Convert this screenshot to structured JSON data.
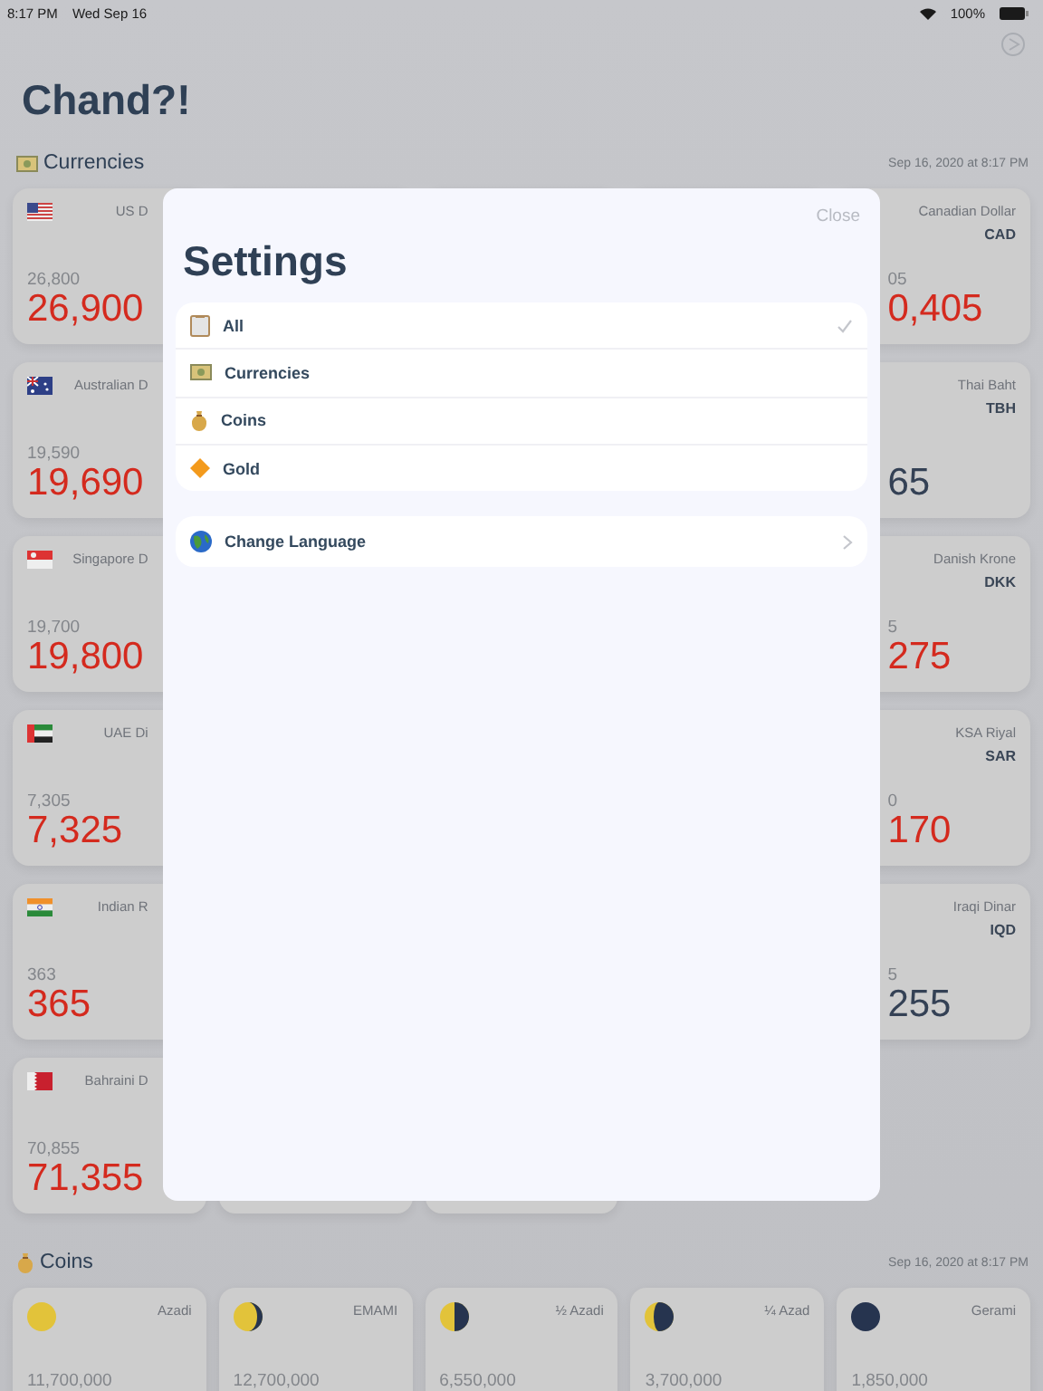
{
  "status_bar": {
    "time": "8:17 PM",
    "date": "Wed Sep 16",
    "battery": "100%"
  },
  "app_title": "Chand?!",
  "currencies": {
    "title": "Currencies",
    "updated": "Sep 16, 2020 at 8:17 PM",
    "rows": [
      {
        "left": {
          "name": "US D",
          "previous": "26,800",
          "price": "26,900",
          "rising": true
        },
        "right": {
          "name": "Canadian Dollar",
          "code": "CAD",
          "previous": "05",
          "price": "0,405",
          "rising": true
        }
      },
      {
        "left": {
          "name": "Australian D",
          "previous": "19,590",
          "price": "19,690",
          "rising": true
        },
        "right": {
          "name": "Thai Baht",
          "code": "TBH",
          "price": "65",
          "rising": false
        }
      },
      {
        "left": {
          "name": "Singapore D",
          "previous": "19,700",
          "price": "19,800",
          "rising": true
        },
        "right": {
          "name": "Danish Krone",
          "code": "DKK",
          "previous": "5",
          "price": "275",
          "rising": true
        }
      },
      {
        "left": {
          "name": "UAE Di",
          "previous": "7,305",
          "price": "7,325",
          "rising": true
        },
        "right": {
          "name": "KSA Riyal",
          "code": "SAR",
          "previous": "0",
          "price": "170",
          "rising": true
        }
      },
      {
        "left": {
          "name": "Indian R",
          "previous": "363",
          "price": "365",
          "rising": true
        },
        "right": {
          "name": "Iraqi Dinar",
          "code": "IQD",
          "previous": "5",
          "price": "255",
          "rising": false
        }
      },
      {
        "left": {
          "name": "Bahraini D",
          "previous": "70,855",
          "price": "71,355",
          "rising": true
        }
      }
    ]
  },
  "coins": {
    "title": "Coins",
    "updated": "Sep 16, 2020 at 8:17 PM",
    "cards": [
      {
        "name": "Azadi",
        "price": "11,700,000"
      },
      {
        "name": "EMAMI",
        "price": "12,700,000"
      },
      {
        "name": "½ Azadi",
        "price": "6,550,000"
      },
      {
        "name": "¼ Azad",
        "price": "3,700,000"
      },
      {
        "name": "Gerami",
        "price": "1,850,000"
      }
    ]
  },
  "settings": {
    "close": "Close",
    "title": "Settings",
    "filters": [
      {
        "label": "All",
        "selected": true
      },
      {
        "label": "Currencies",
        "selected": false
      },
      {
        "label": "Coins",
        "selected": false
      },
      {
        "label": "Gold",
        "selected": false
      }
    ],
    "language": {
      "label": "Change Language"
    }
  }
}
